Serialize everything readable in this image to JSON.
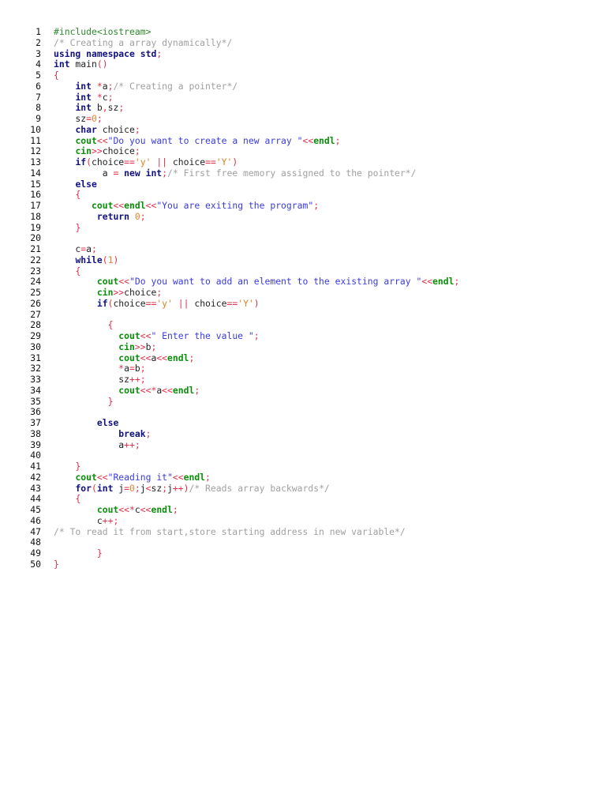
{
  "colors": {
    "background": "#ffffff",
    "line_number": "#111111",
    "preprocessor": "#2e8b2e",
    "comment": "#a0a0a0",
    "keyword": "#101080",
    "stream": "#0a8f0a",
    "string": "#3a3adf",
    "operator": "#e0304a",
    "number": "#f08030",
    "char_literal": "#e08020",
    "identifier": "#222222"
  },
  "code": {
    "lines": [
      {
        "n": "1",
        "tokens": [
          [
            "pre",
            "#include<iostream>"
          ]
        ]
      },
      {
        "n": "2",
        "tokens": [
          [
            "cmt",
            "/* Creating a array dynamically*/"
          ]
        ]
      },
      {
        "n": "3",
        "tokens": [
          [
            "kw",
            "using namespace std"
          ],
          [
            "op",
            ";"
          ]
        ]
      },
      {
        "n": "4",
        "tokens": [
          [
            "kw",
            "int"
          ],
          [
            "id",
            " main"
          ],
          [
            "op",
            "()"
          ]
        ]
      },
      {
        "n": "5",
        "tokens": [
          [
            "op",
            "{"
          ]
        ]
      },
      {
        "n": "6",
        "tokens": [
          [
            "id",
            "    "
          ],
          [
            "kw",
            "int"
          ],
          [
            "id",
            " "
          ],
          [
            "op",
            "*"
          ],
          [
            "id",
            "a"
          ],
          [
            "op",
            ";"
          ],
          [
            "cmt",
            "/* Creating a pointer*/"
          ]
        ]
      },
      {
        "n": "7",
        "tokens": [
          [
            "id",
            "    "
          ],
          [
            "kw",
            "int"
          ],
          [
            "id",
            " "
          ],
          [
            "op",
            "*"
          ],
          [
            "id",
            "c"
          ],
          [
            "op",
            ";"
          ]
        ]
      },
      {
        "n": "8",
        "tokens": [
          [
            "id",
            "    "
          ],
          [
            "kw",
            "int"
          ],
          [
            "id",
            " b"
          ],
          [
            "op",
            ","
          ],
          [
            "id",
            "sz"
          ],
          [
            "op",
            ";"
          ]
        ]
      },
      {
        "n": "9",
        "tokens": [
          [
            "id",
            "    sz"
          ],
          [
            "op",
            "="
          ],
          [
            "num",
            "0"
          ],
          [
            "op",
            ";"
          ]
        ]
      },
      {
        "n": "10",
        "tokens": [
          [
            "id",
            "    "
          ],
          [
            "kw",
            "char"
          ],
          [
            "id",
            " choice"
          ],
          [
            "op",
            ";"
          ]
        ]
      },
      {
        "n": "11",
        "tokens": [
          [
            "id",
            "    "
          ],
          [
            "io",
            "cout"
          ],
          [
            "op",
            "<<"
          ],
          [
            "str",
            "\"Do you want to create a new array \""
          ],
          [
            "op",
            "<<"
          ],
          [
            "io",
            "endl"
          ],
          [
            "op",
            ";"
          ]
        ]
      },
      {
        "n": "12",
        "tokens": [
          [
            "id",
            "    "
          ],
          [
            "io",
            "cin"
          ],
          [
            "op",
            ">>"
          ],
          [
            "id",
            "choice"
          ],
          [
            "op",
            ";"
          ]
        ]
      },
      {
        "n": "13",
        "tokens": [
          [
            "id",
            "    "
          ],
          [
            "kw",
            "if"
          ],
          [
            "op",
            "("
          ],
          [
            "id",
            "choice"
          ],
          [
            "op",
            "=="
          ],
          [
            "ch",
            "'y'"
          ],
          [
            "id",
            " "
          ],
          [
            "op",
            "||"
          ],
          [
            "id",
            " choice"
          ],
          [
            "op",
            "=="
          ],
          [
            "ch",
            "'Y'"
          ],
          [
            "op",
            ")"
          ]
        ]
      },
      {
        "n": "14",
        "tokens": [
          [
            "id",
            "         a "
          ],
          [
            "op",
            "="
          ],
          [
            "id",
            " "
          ],
          [
            "kw",
            "new"
          ],
          [
            "id",
            " "
          ],
          [
            "kw",
            "int"
          ],
          [
            "op",
            ";"
          ],
          [
            "cmt",
            "/* First free memory assigned to the pointer*/"
          ]
        ]
      },
      {
        "n": "15",
        "tokens": [
          [
            "id",
            "    "
          ],
          [
            "kw",
            "else"
          ]
        ]
      },
      {
        "n": "16",
        "tokens": [
          [
            "id",
            "    "
          ],
          [
            "op",
            "{"
          ]
        ]
      },
      {
        "n": "17",
        "tokens": [
          [
            "id",
            "       "
          ],
          [
            "io",
            "cout"
          ],
          [
            "op",
            "<<"
          ],
          [
            "io",
            "endl"
          ],
          [
            "op",
            "<<"
          ],
          [
            "str",
            "\"You are exiting the program\""
          ],
          [
            "op",
            ";"
          ]
        ]
      },
      {
        "n": "18",
        "tokens": [
          [
            "id",
            "        "
          ],
          [
            "kw",
            "return"
          ],
          [
            "id",
            " "
          ],
          [
            "num",
            "0"
          ],
          [
            "op",
            ";"
          ]
        ]
      },
      {
        "n": "19",
        "tokens": [
          [
            "id",
            "    "
          ],
          [
            "op",
            "}"
          ]
        ]
      },
      {
        "n": "20",
        "tokens": []
      },
      {
        "n": "21",
        "tokens": [
          [
            "id",
            "    c"
          ],
          [
            "op",
            "="
          ],
          [
            "id",
            "a"
          ],
          [
            "op",
            ";"
          ]
        ]
      },
      {
        "n": "22",
        "tokens": [
          [
            "id",
            "    "
          ],
          [
            "kw",
            "while"
          ],
          [
            "op",
            "("
          ],
          [
            "num",
            "1"
          ],
          [
            "op",
            ")"
          ]
        ]
      },
      {
        "n": "23",
        "tokens": [
          [
            "id",
            "    "
          ],
          [
            "op",
            "{"
          ]
        ]
      },
      {
        "n": "24",
        "tokens": [
          [
            "id",
            "        "
          ],
          [
            "io",
            "cout"
          ],
          [
            "op",
            "<<"
          ],
          [
            "str",
            "\"Do you want to add an element to the existing array \""
          ],
          [
            "op",
            "<<"
          ],
          [
            "io",
            "endl"
          ],
          [
            "op",
            ";"
          ]
        ]
      },
      {
        "n": "25",
        "tokens": [
          [
            "id",
            "        "
          ],
          [
            "io",
            "cin"
          ],
          [
            "op",
            ">>"
          ],
          [
            "id",
            "choice"
          ],
          [
            "op",
            ";"
          ]
        ]
      },
      {
        "n": "26",
        "tokens": [
          [
            "id",
            "        "
          ],
          [
            "kw",
            "if"
          ],
          [
            "op",
            "("
          ],
          [
            "id",
            "choice"
          ],
          [
            "op",
            "=="
          ],
          [
            "ch",
            "'y'"
          ],
          [
            "id",
            " "
          ],
          [
            "op",
            "||"
          ],
          [
            "id",
            " choice"
          ],
          [
            "op",
            "=="
          ],
          [
            "ch",
            "'Y'"
          ],
          [
            "op",
            ")"
          ]
        ]
      },
      {
        "n": "27",
        "tokens": []
      },
      {
        "n": "28",
        "tokens": [
          [
            "id",
            "          "
          ],
          [
            "op",
            "{"
          ]
        ]
      },
      {
        "n": "29",
        "tokens": [
          [
            "id",
            "            "
          ],
          [
            "io",
            "cout"
          ],
          [
            "op",
            "<<"
          ],
          [
            "str",
            "\" Enter the value \""
          ],
          [
            "op",
            ";"
          ]
        ]
      },
      {
        "n": "30",
        "tokens": [
          [
            "id",
            "            "
          ],
          [
            "io",
            "cin"
          ],
          [
            "op",
            ">>"
          ],
          [
            "id",
            "b"
          ],
          [
            "op",
            ";"
          ]
        ]
      },
      {
        "n": "31",
        "tokens": [
          [
            "id",
            "            "
          ],
          [
            "io",
            "cout"
          ],
          [
            "op",
            "<<"
          ],
          [
            "id",
            "a"
          ],
          [
            "op",
            "<<"
          ],
          [
            "io",
            "endl"
          ],
          [
            "op",
            ";"
          ]
        ]
      },
      {
        "n": "32",
        "tokens": [
          [
            "id",
            "            "
          ],
          [
            "op",
            "*"
          ],
          [
            "id",
            "a"
          ],
          [
            "op",
            "="
          ],
          [
            "id",
            "b"
          ],
          [
            "op",
            ";"
          ]
        ]
      },
      {
        "n": "33",
        "tokens": [
          [
            "id",
            "            sz"
          ],
          [
            "op",
            "++;"
          ]
        ]
      },
      {
        "n": "34",
        "tokens": [
          [
            "id",
            "            "
          ],
          [
            "io",
            "cout"
          ],
          [
            "op",
            "<<*"
          ],
          [
            "id",
            "a"
          ],
          [
            "op",
            "<<"
          ],
          [
            "io",
            "endl"
          ],
          [
            "op",
            ";"
          ]
        ]
      },
      {
        "n": "35",
        "tokens": [
          [
            "id",
            "          "
          ],
          [
            "op",
            "}"
          ]
        ]
      },
      {
        "n": "36",
        "tokens": []
      },
      {
        "n": "37",
        "tokens": [
          [
            "id",
            "        "
          ],
          [
            "kw",
            "else"
          ]
        ]
      },
      {
        "n": "38",
        "tokens": [
          [
            "id",
            "            "
          ],
          [
            "kw",
            "break"
          ],
          [
            "op",
            ";"
          ]
        ]
      },
      {
        "n": "39",
        "tokens": [
          [
            "id",
            "            a"
          ],
          [
            "op",
            "++;"
          ]
        ]
      },
      {
        "n": "40",
        "tokens": []
      },
      {
        "n": "41",
        "tokens": [
          [
            "id",
            "    "
          ],
          [
            "op",
            "}"
          ]
        ]
      },
      {
        "n": "42",
        "tokens": [
          [
            "id",
            "    "
          ],
          [
            "io",
            "cout"
          ],
          [
            "op",
            "<<"
          ],
          [
            "str",
            "\"Reading it\""
          ],
          [
            "op",
            "<<"
          ],
          [
            "io",
            "endl"
          ],
          [
            "op",
            ";"
          ]
        ]
      },
      {
        "n": "43",
        "tokens": [
          [
            "id",
            "    "
          ],
          [
            "kw",
            "for"
          ],
          [
            "op",
            "("
          ],
          [
            "kw",
            "int"
          ],
          [
            "id",
            " j"
          ],
          [
            "op",
            "="
          ],
          [
            "num",
            "0"
          ],
          [
            "op",
            ";"
          ],
          [
            "id",
            "j"
          ],
          [
            "op",
            "<"
          ],
          [
            "id",
            "sz"
          ],
          [
            "op",
            ";"
          ],
          [
            "id",
            "j"
          ],
          [
            "op",
            "++)"
          ],
          [
            "cmt",
            "/* Reads array backwards*/"
          ]
        ]
      },
      {
        "n": "44",
        "tokens": [
          [
            "id",
            "    "
          ],
          [
            "op",
            "{"
          ]
        ]
      },
      {
        "n": "45",
        "tokens": [
          [
            "id",
            "        "
          ],
          [
            "io",
            "cout"
          ],
          [
            "op",
            "<<*"
          ],
          [
            "id",
            "c"
          ],
          [
            "op",
            "<<"
          ],
          [
            "io",
            "endl"
          ],
          [
            "op",
            ";"
          ]
        ]
      },
      {
        "n": "46",
        "tokens": [
          [
            "id",
            "        c"
          ],
          [
            "op",
            "++;"
          ]
        ]
      },
      {
        "n": "47",
        "tokens": [
          [
            "cmt",
            "/* To read it from start,store starting address in new variable*/"
          ]
        ]
      },
      {
        "n": "48",
        "tokens": []
      },
      {
        "n": "49",
        "tokens": [
          [
            "id",
            "        "
          ],
          [
            "op",
            "}"
          ]
        ]
      },
      {
        "n": "50",
        "tokens": [
          [
            "op",
            "}"
          ]
        ]
      }
    ]
  }
}
